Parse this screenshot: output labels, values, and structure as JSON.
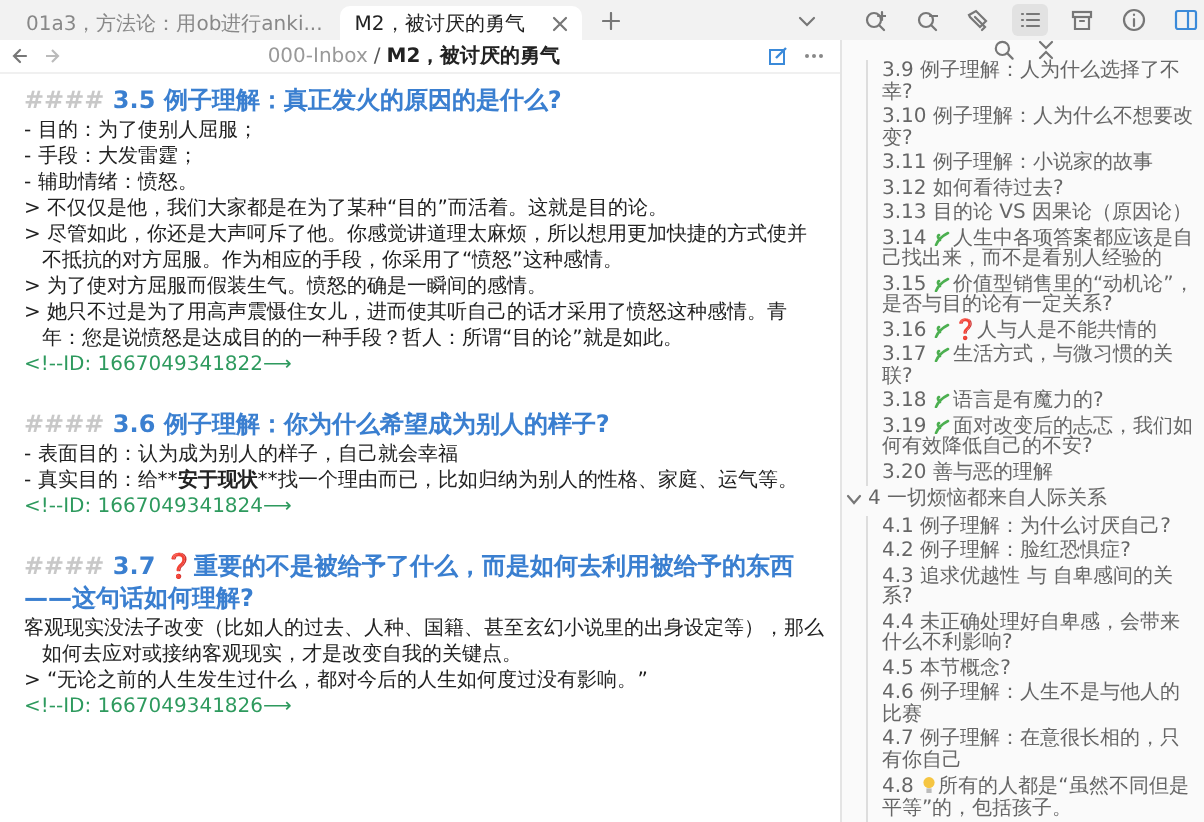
{
  "tabs": [
    {
      "label": "01a3，方法论：用ob进行anki...",
      "selected": false,
      "closable": false
    },
    {
      "label": "M2，被讨厌的勇气",
      "selected": true,
      "closable": true
    }
  ],
  "breadcrumb": {
    "folder": "000-Inbox",
    "separator": "/",
    "file": "M2，被讨厌的勇气"
  },
  "sidebar_toolbar": [
    {
      "selected": false
    },
    {
      "selected": false
    },
    {
      "selected": false
    },
    {
      "selected": true
    },
    {
      "selected": false
    },
    {
      "selected": false
    },
    {
      "selected": false
    }
  ],
  "sections": [
    {
      "marker": "####",
      "title": "3.5 例子理解：真正发火的原因的是什么?",
      "lines": [
        [
          {
            "text": "- 目的：为了使别人屈服；"
          }
        ],
        [
          {
            "text": "- 手段：大发雷霆；"
          }
        ],
        [
          {
            "text": "- 辅助情绪：愤怒。"
          }
        ],
        [
          {
            "text": "> 不仅仅是他，我们大家都是在为了某种“目的”而活着。这就是目的论。"
          }
        ],
        [
          {
            "text": "> 尽管如此，你还是大声呵斥了他。你感觉讲道理太麻烦，所以想用更加快捷的方式使并不抵抗的对方屈服。作为相应的手段，你采用了“愤怒”这种感情。"
          }
        ],
        [
          {
            "text": "> 为了使对方屈服而假装生气。愤怒的确是一瞬间的感情。"
          }
        ],
        [
          {
            "text": "> 她只不过是为了用高声震慑住女儿，进而使其听自己的话才采用了愤怒这种感情。青年：您是说愤怒是达成目的的一种手段？哲人：所谓“目的论”就是如此。"
          }
        ]
      ],
      "comment": "<!--ID: 1667049341822⟶"
    },
    {
      "marker": "####",
      "title": "3.6 例子理解：你为什么希望成为别人的样子?",
      "lines": [
        [
          {
            "text": "- 表面目的：认为成为别人的样子，自己就会幸福"
          }
        ],
        [
          {
            "text": "- 真实目的：给**"
          },
          {
            "text": "安于现状",
            "bold": true
          },
          {
            "text": "**找一个理由而已，比如归纳为别人的性格、家庭、运气等。"
          }
        ]
      ],
      "comment": "<!--ID: 1667049341824⟶"
    },
    {
      "marker": "####",
      "title": "3.7 ❓重要的不是被给予了什么，而是如何去利用被给予的东西——这句话如何理解?",
      "lines": [
        [
          {
            "text": "客观现实没法子改变（比如人的过去、人种、国籍、甚至玄幻小说里的出身设定等），那么如何去应对或接纳客观现实，才是改变自我的关键点。"
          }
        ],
        [
          {
            "text": "> “无论之前的人生发生过什么，都对今后的人生如何度过没有影响。”"
          }
        ]
      ],
      "comment": "<!--ID: 1667049341826⟶"
    }
  ],
  "outline": [
    {
      "label": "3.9 例子理解：人为什么选择了不幸?",
      "kind": "plain"
    },
    {
      "label": "3.10 例子理解：人为什么不想要改变?",
      "kind": "plain"
    },
    {
      "label": "3.11 例子理解：小说家的故事",
      "kind": "plain"
    },
    {
      "label": "3.12 如何看待过去?",
      "kind": "plain"
    },
    {
      "label": "3.13 目的论 VS 因果论（原因论）",
      "kind": "plain"
    },
    {
      "label": "3.14 人生中各项答案都应该是自己找出来，而不是看别人经验的",
      "kind": "sprout"
    },
    {
      "label": "3.15 价值型销售里的“动机论”，是否与目的论有一定关系?",
      "kind": "sprout"
    },
    {
      "label": "3.16 ❓人与人是不能共情的",
      "kind": "sprout"
    },
    {
      "label": "3.17 生活方式，与微习惯的关联?",
      "kind": "sprout"
    },
    {
      "label": "3.18 语言是有魔力的?",
      "kind": "sprout"
    },
    {
      "label": "3.19 面对改变后的忐忑，我们如何有效降低自己的不安?",
      "kind": "sprout"
    },
    {
      "label": "3.20 善与恶的理解",
      "kind": "plain"
    },
    {
      "label": "4 一切烦恼都来自人际关系",
      "kind": "group",
      "expanded": true,
      "children": [
        {
          "label": "4.1 例子理解：为什么讨厌自己?",
          "kind": "plain"
        },
        {
          "label": "4.2 例子理解：脸红恐惧症?",
          "kind": "plain"
        },
        {
          "label": "4.3 追求优越性 与 自卑感间的关系?",
          "kind": "plain"
        },
        {
          "label": "4.4 未正确处理好自卑感，会带来什么不利影响?",
          "kind": "plain"
        },
        {
          "label": "4.5 本节概念?",
          "kind": "plain"
        },
        {
          "label": "4.6 例子理解：人生不是与他人的比赛",
          "kind": "plain"
        },
        {
          "label": "4.7 例子理解：在意很长相的，只有你自己",
          "kind": "plain"
        },
        {
          "label": "4.8 所有的人都是“虽然不同但是平等”的，包括孩子。",
          "kind": "bulb"
        }
      ]
    }
  ]
}
